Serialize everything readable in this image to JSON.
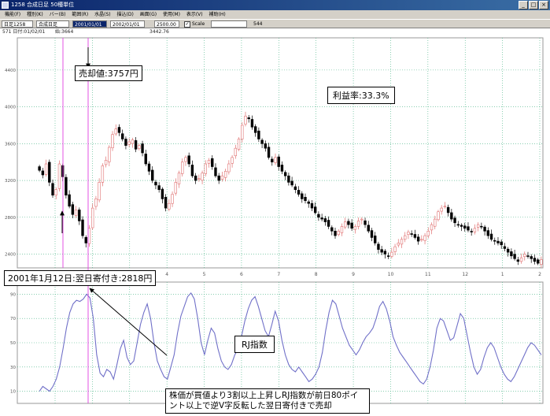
{
  "window": {
    "title": "1258 合成日足 50種単位",
    "menu": [
      "機能(F)",
      "種別(K)",
      "バー(B)",
      "範囲(R)",
      "水晶(S)",
      "描込(D)",
      "画面(G)",
      "使用(M)",
      "表示(V)",
      "補助(H)"
    ],
    "toolbar": {
      "code": "日足1258",
      "name": "合成日足",
      "period_selected": "2001/01/01",
      "period_end": "2002/01/01",
      "value": "2500.00",
      "scale_label": "Scale",
      "count": "544"
    },
    "infobar": {
      "date": "571 日付:01/02/01",
      "open": "始:3664",
      "price": "3442.76"
    }
  },
  "colors": {
    "up": "#e07070",
    "down": "#000000",
    "grid": "#40b080",
    "rj_line": "#7070c8",
    "marker_line": "#e040e0"
  },
  "annotations": {
    "sell_price": "売却値:3757円",
    "buy_date": "2001年1月12日:翌日寄付き:2818円",
    "profit_rate": "利益率:33.3%",
    "rj_label": "RJ指数",
    "note": "株価が買値より3割以上上昇しRJ指数が前日80ポイント以上で逆V字反転した翌日寄付きで売却"
  },
  "chart_data": [
    {
      "type": "candlestick",
      "title": "",
      "ylim": [
        2250,
        4750
      ],
      "yticks": [
        2400,
        2800,
        3200,
        3600,
        4000,
        4400
      ],
      "xticks": [
        "1",
        "2",
        "3",
        "4",
        "5",
        "6",
        "7",
        "8",
        "9",
        "10",
        "11",
        "12",
        "1",
        "2"
      ],
      "close": [
        3310,
        3260,
        3380,
        3180,
        3040,
        3100,
        3380,
        3240,
        3040,
        2920,
        2830,
        2880,
        2760,
        2600,
        2520,
        2680,
        2900,
        3000,
        3180,
        3360,
        3420,
        3560,
        3700,
        3760,
        3720,
        3650,
        3580,
        3620,
        3640,
        3540,
        3580,
        3500,
        3380,
        3300,
        3200,
        3150,
        3100,
        3000,
        2900,
        2950,
        3050,
        3180,
        3280,
        3400,
        3450,
        3380,
        3250,
        3200,
        3220,
        3280,
        3380,
        3420,
        3350,
        3250,
        3200,
        3250,
        3300,
        3380,
        3450,
        3550,
        3650,
        3800,
        3900,
        3870,
        3780,
        3720,
        3650,
        3600,
        3550,
        3450,
        3400,
        3450,
        3350,
        3300,
        3250,
        3180,
        3150,
        3100,
        3050,
        3000,
        2980,
        2950,
        2900,
        2850,
        2800,
        2780,
        2750,
        2700,
        2650,
        2600,
        2650,
        2700,
        2750,
        2720,
        2680,
        2700,
        2760,
        2780,
        2720,
        2650,
        2580,
        2520,
        2450,
        2420,
        2400,
        2380,
        2420,
        2480,
        2520,
        2560,
        2600,
        2640,
        2620,
        2580,
        2540,
        2560,
        2600,
        2650,
        2720,
        2780,
        2860,
        2900,
        2920,
        2850,
        2780,
        2740,
        2720,
        2700,
        2680,
        2660,
        2640,
        2680,
        2720,
        2700,
        2650,
        2600,
        2560,
        2540,
        2520,
        2500,
        2460,
        2420,
        2380,
        2350,
        2320,
        2360,
        2400,
        2380,
        2350,
        2320,
        2300,
        2340
      ]
    },
    {
      "type": "line",
      "title": "",
      "ylim": [
        0,
        100
      ],
      "yticks": [
        10,
        30,
        50,
        70,
        90
      ],
      "series": [
        {
          "name": "RJ指数",
          "values": [
            10,
            14,
            12,
            10,
            14,
            20,
            30,
            45,
            62,
            75,
            82,
            85,
            84,
            86,
            90,
            87,
            70,
            40,
            25,
            22,
            28,
            26,
            20,
            32,
            45,
            52,
            38,
            32,
            35,
            50,
            65,
            75,
            82,
            70,
            50,
            35,
            28,
            22,
            20,
            30,
            40,
            58,
            72,
            80,
            88,
            91,
            86,
            70,
            50,
            40,
            52,
            62,
            58,
            45,
            35,
            30,
            28,
            32,
            40,
            45,
            55,
            68,
            78,
            85,
            88,
            80,
            70,
            60,
            55,
            65,
            76,
            68,
            52,
            40,
            32,
            28,
            26,
            30,
            26,
            22,
            18,
            20,
            24,
            30,
            42,
            60,
            75,
            85,
            82,
            72,
            62,
            55,
            48,
            44,
            40,
            44,
            50,
            55,
            58,
            62,
            70,
            80,
            84,
            78,
            68,
            55,
            48,
            42,
            38,
            34,
            30,
            26,
            22,
            18,
            16,
            20,
            30,
            44,
            62,
            70,
            68,
            60,
            52,
            54,
            64,
            74,
            70,
            56,
            42,
            30,
            24,
            28,
            38,
            46,
            50,
            46,
            38,
            30,
            24,
            20,
            18,
            22,
            28,
            34,
            40,
            46,
            50,
            48,
            44,
            40
          ]
        }
      ]
    }
  ]
}
